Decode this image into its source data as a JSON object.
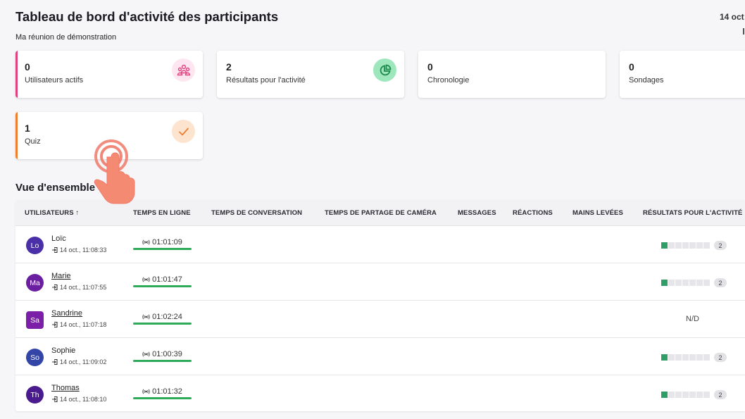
{
  "header": {
    "title": "Tableau de bord d'activité des participants",
    "subtitle": "Ma réunion de démonstration",
    "date": "14 oct"
  },
  "cards": [
    {
      "value": "0",
      "label": "Utilisateurs actifs",
      "accent": "#e0407f",
      "icon": "users-icon",
      "icon_bg": "#fde6ef",
      "icon_color": "#e0407f"
    },
    {
      "value": "2",
      "label": "Résultats pour l'activité",
      "accent": "#ffffff",
      "icon": "pie-chart-icon",
      "icon_bg": "#9ee7bd",
      "icon_color": "#1f8a4c"
    },
    {
      "value": "0",
      "label": "Chronologie",
      "accent": "#ffffff",
      "icon": "",
      "icon_bg": "",
      "icon_color": ""
    },
    {
      "value": "0",
      "label": "Sondages",
      "accent": "#ffffff",
      "icon": "",
      "icon_bg": "",
      "icon_color": ""
    },
    {
      "value": "1",
      "label": "Quiz",
      "accent": "#ee7f2f",
      "icon": "check-icon",
      "icon_bg": "#fde4cf",
      "icon_color": "#ee7f2f"
    }
  ],
  "overview": {
    "title": "Vue d'ensemble",
    "columns": {
      "users": "UTILISATEURS ↑",
      "online": "TEMPS EN LIGNE",
      "conversation": "TEMPS DE CONVERSATION",
      "camera": "TEMPS DE PARTAGE DE CAMÉRA",
      "messages": "MESSAGES",
      "reactions": "RÉACTIONS",
      "hands": "MAINS LEVÉES",
      "results": "RÉSULTATS POUR L'ACTIVITÉ"
    },
    "rows": [
      {
        "initials": "Lo",
        "name": "Loïc",
        "joined": "14 oct., 11:08:33",
        "online": "01:01:09",
        "avatar_color": "#4a2fa8",
        "results_filled": 1,
        "results_total": 7,
        "results_count": "2",
        "results_text": ""
      },
      {
        "initials": "Ma",
        "name": "Marie",
        "joined": "14 oct., 11:07:55",
        "online": "01:01:47",
        "avatar_color": "#6a1fa0",
        "results_filled": 1,
        "results_total": 7,
        "results_count": "2",
        "results_text": ""
      },
      {
        "initials": "Sa",
        "name": "Sandrine",
        "joined": "14 oct., 11:07:18",
        "online": "01:02:24",
        "avatar_color": "#7b1fa8",
        "results_filled": 0,
        "results_total": 0,
        "results_count": "",
        "results_text": "N/D"
      },
      {
        "initials": "So",
        "name": "Sophie",
        "joined": "14 oct., 11:09:02",
        "online": "01:00:39",
        "avatar_color": "#3346a8",
        "results_filled": 1,
        "results_total": 7,
        "results_count": "2",
        "results_text": ""
      },
      {
        "initials": "Th",
        "name": "Thomas",
        "joined": "14 oct., 11:08:10",
        "online": "01:01:32",
        "avatar_color": "#4a1a8f",
        "results_filled": 1,
        "results_total": 7,
        "results_count": "2",
        "results_text": ""
      }
    ]
  }
}
